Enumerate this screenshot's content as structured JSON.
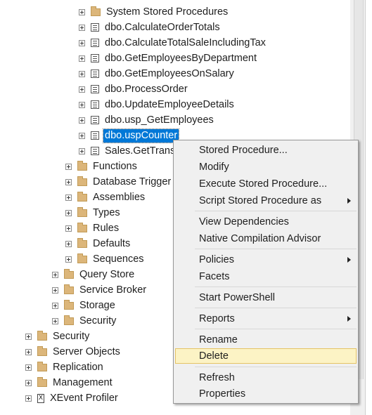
{
  "tree": {
    "stored_procedures": [
      {
        "label": "System Stored Procedures",
        "icon": "folder-icon"
      },
      {
        "label": "dbo.CalculateOrderTotals",
        "icon": "stored-procedure-icon"
      },
      {
        "label": "dbo.CalculateTotalSaleIncludingTax",
        "icon": "stored-procedure-icon"
      },
      {
        "label": "dbo.GetEmployeesByDepartment",
        "icon": "stored-procedure-icon"
      },
      {
        "label": "dbo.GetEmployeesOnSalary",
        "icon": "stored-procedure-icon"
      },
      {
        "label": "dbo.ProcessOrder",
        "icon": "stored-procedure-icon"
      },
      {
        "label": "dbo.UpdateEmployeeDetails",
        "icon": "stored-procedure-icon"
      },
      {
        "label": "dbo.usp_GetEmployees",
        "icon": "stored-procedure-icon"
      },
      {
        "label": "dbo.uspCounter",
        "icon": "stored-procedure-icon",
        "selected": true
      },
      {
        "label": "Sales.GetTransa",
        "icon": "stored-procedure-icon"
      }
    ],
    "programmability_folders": [
      "Functions",
      "Database Trigger",
      "Assemblies",
      "Types",
      "Rules",
      "Defaults",
      "Sequences"
    ],
    "database_folders": [
      "Query Store",
      "Service Broker",
      "Storage",
      "Security"
    ],
    "server_folders": [
      {
        "label": "Security",
        "icon": "folder-icon"
      },
      {
        "label": "Server Objects",
        "icon": "folder-icon"
      },
      {
        "label": "Replication",
        "icon": "folder-icon"
      },
      {
        "label": "Management",
        "icon": "folder-icon"
      },
      {
        "label": "XEvent Profiler",
        "icon": "xevent-profiler-icon",
        "glyph": "X"
      }
    ]
  },
  "context_menu": {
    "items": [
      {
        "label": "Stored Procedure...",
        "submenu": false
      },
      {
        "label": "Modify",
        "submenu": false
      },
      {
        "label": "Execute Stored Procedure...",
        "submenu": false
      },
      {
        "label": "Script Stored Procedure as",
        "submenu": true
      },
      {
        "label": "View Dependencies",
        "submenu": false
      },
      {
        "label": "Native Compilation Advisor",
        "submenu": false
      },
      {
        "label": "Policies",
        "submenu": true
      },
      {
        "label": "Facets",
        "submenu": false
      },
      {
        "label": "Start PowerShell",
        "submenu": false
      },
      {
        "label": "Reports",
        "submenu": true
      },
      {
        "label": "Rename",
        "submenu": false
      },
      {
        "label": "Delete",
        "submenu": false,
        "highlighted": true
      },
      {
        "label": "Refresh",
        "submenu": false
      },
      {
        "label": "Properties",
        "submenu": false
      }
    ]
  },
  "colors": {
    "selection": "#0078d7",
    "menu_highlight": "#fcf3c5",
    "menu_highlight_border": "#e5c365",
    "folder": "#dcb67a"
  }
}
